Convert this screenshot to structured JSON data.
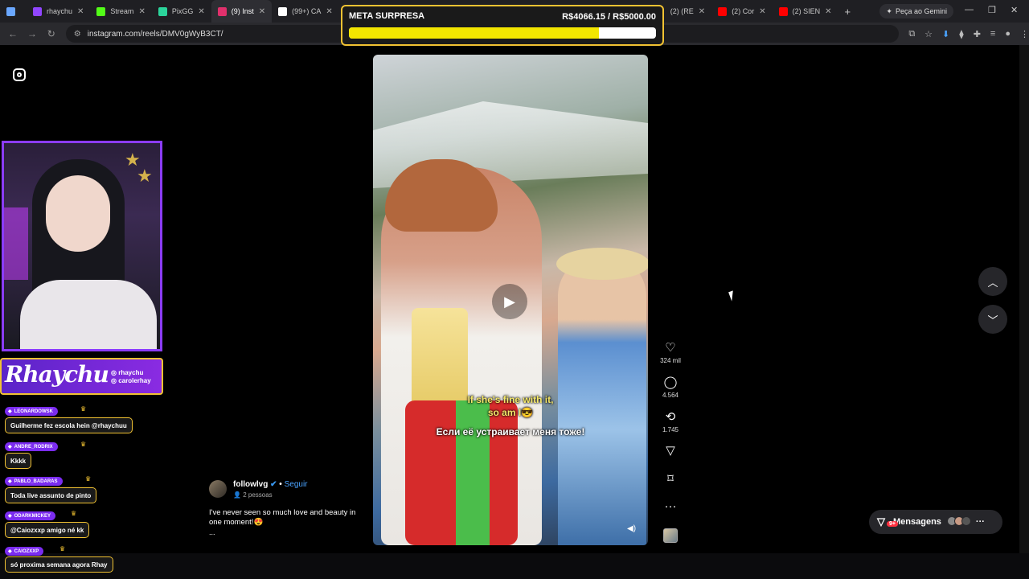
{
  "browser": {
    "tabs": [
      {
        "label": "",
        "color": "#6aa7ff"
      },
      {
        "label": "rhaychu",
        "color": "#9146ff"
      },
      {
        "label": "Stream",
        "color": "#53fc18"
      },
      {
        "label": "PixGG",
        "color": "#2bd49b"
      },
      {
        "label": "(9) Inst",
        "color": "#e1306c",
        "active": true
      },
      {
        "label": "(99+) CA",
        "color": "#ffffff"
      },
      {
        "label": "(2) (RE",
        "color": "#ff0000"
      },
      {
        "label": "(2) Cor",
        "color": "#ff0000"
      },
      {
        "label": "(2) SIEN",
        "color": "#ff0000"
      }
    ],
    "gemini_label": "Peça ao Gemini",
    "url": "instagram.com/reels/DMV0gWyB3CT/"
  },
  "goal": {
    "title": "META SURPRESA",
    "amount": "R$4066.15 / R$5000.00",
    "progress": 0.813
  },
  "reel": {
    "caption_line1": "If she's fine with it,",
    "caption_line2": "so am I😎",
    "caption_line3": "Если её устраивает меня тоже!"
  },
  "actions": {
    "likes": "324 mil",
    "comments": "4.564",
    "reposts": "1.745"
  },
  "post": {
    "author": "followlvg",
    "follow": "Seguir",
    "people": "2 pessoas",
    "description": "I've never seen so much love and beauty in one moment!😍",
    "more": "..."
  },
  "messages": {
    "label": "Mensagens",
    "badge": "9+"
  },
  "stream_banner": {
    "name": "Rhaychu",
    "handle1": "rhaychu",
    "handle2": "carolerhay"
  },
  "chat": [
    {
      "user": "LEONARDOWSK",
      "message": "Guilherme fez escola hein @rhaychuu"
    },
    {
      "user": "ANDRE_RODRIX",
      "message": "Kkkk"
    },
    {
      "user": "PABLO_BADARAS",
      "message": "Toda live assunto de pinto"
    },
    {
      "user": "ODARKMICKEY",
      "message": "@Caiozxxp amigo né kk"
    },
    {
      "user": "CAIOZXXP",
      "message": "só proxima semana agora Rhay"
    }
  ]
}
